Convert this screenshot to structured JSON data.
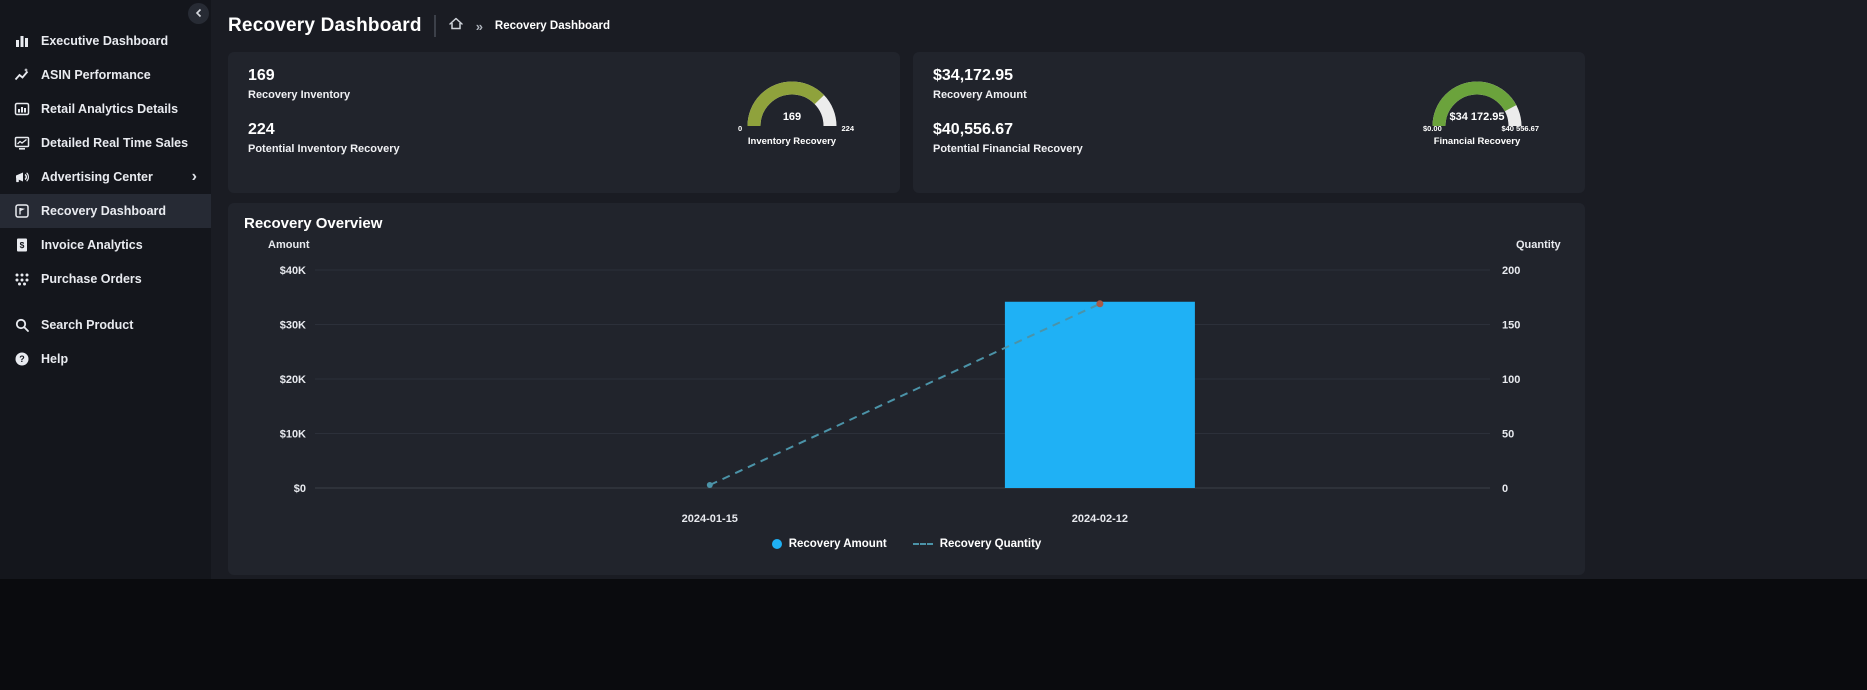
{
  "app": {
    "bg": "#1a1c23",
    "sidebar_bg": "#14161c",
    "card_bg": "#21242c",
    "accent_blue": "#1fb1f5"
  },
  "sidebar": {
    "items": [
      {
        "label": "Executive Dashboard"
      },
      {
        "label": "ASIN Performance"
      },
      {
        "label": "Retail Analytics Details"
      },
      {
        "label": "Detailed Real Time Sales"
      },
      {
        "label": "Advertising Center",
        "chevron": "›"
      },
      {
        "label": "Recovery Dashboard"
      },
      {
        "label": "Invoice Analytics"
      },
      {
        "label": "Purchase Orders"
      },
      {
        "label": "Search Product"
      },
      {
        "label": "Help"
      }
    ]
  },
  "header": {
    "title": "Recovery Dashboard",
    "crumb_sep": "»",
    "breadcrumb_current": "Recovery Dashboard"
  },
  "cards": {
    "inventory": {
      "value1": "169",
      "label1": "Recovery Inventory",
      "value2": "224",
      "label2": "Potential Inventory Recovery",
      "gauge": {
        "value": 169,
        "max": 224,
        "value_label": "169",
        "min_label": "0",
        "max_label": "224",
        "title": "Inventory Recovery",
        "color": "#8fa23c"
      }
    },
    "financial": {
      "value1": "$34,172.95",
      "label1": "Recovery Amount",
      "value2": "$40,556.67",
      "label2": "Potential Financial Recovery",
      "gauge": {
        "value": 34172.95,
        "max": 40556.67,
        "value_label": "$34 172.95",
        "min_label": "$0.00",
        "max_label": "$40 556.67",
        "title": "Financial Recovery",
        "color": "#6ba33c"
      }
    }
  },
  "overview": {
    "title": "Recovery Overview"
  },
  "chart_data": {
    "type": "bar",
    "subtype": "dual-axis bar + dashed line combo",
    "title": "Recovery Overview",
    "categories": [
      "2024-01-15",
      "2024-02-12"
    ],
    "series": [
      {
        "name": "Recovery Amount",
        "kind": "bar",
        "axis": "left",
        "values": [
          0,
          34172.95
        ],
        "color": "#1fb1f5"
      },
      {
        "name": "Recovery Quantity",
        "kind": "line-dashed",
        "axis": "right",
        "values": [
          0,
          169
        ],
        "color": "#4b93a8"
      }
    ],
    "left_axis": {
      "label": "Amount",
      "tick_labels": [
        "$0",
        "$10K",
        "$20K",
        "$30K",
        "$40K"
      ],
      "tick_values": [
        0,
        10000,
        20000,
        30000,
        40000
      ],
      "range": [
        0,
        40000
      ]
    },
    "right_axis": {
      "label": "Quantity",
      "tick_labels": [
        "0",
        "50",
        "100",
        "150",
        "200"
      ],
      "tick_values": [
        0,
        50,
        100,
        150,
        200
      ],
      "range": [
        0,
        200
      ]
    },
    "legend": [
      {
        "label": "Recovery Amount",
        "marker": "circle",
        "color": "#1fb1f5"
      },
      {
        "label": "Recovery Quantity",
        "marker": "dash",
        "color": "#4b93a8"
      }
    ],
    "grid": true
  }
}
